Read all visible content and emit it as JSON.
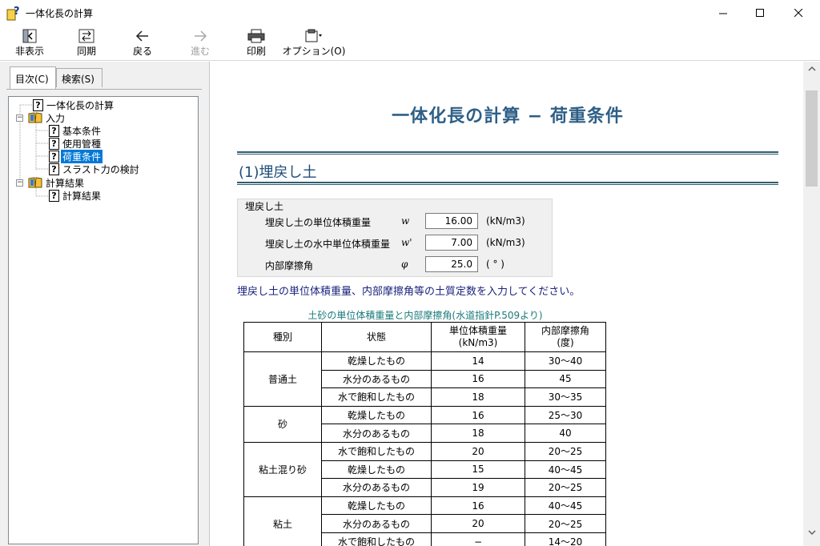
{
  "window": {
    "title": "一体化長の計算"
  },
  "toolbar": {
    "buttons": [
      {
        "label": "非表示",
        "icon": "hide-pane-icon"
      },
      {
        "label": "同期",
        "icon": "sync-icon"
      },
      {
        "label": "戻る",
        "icon": "back-arrow-icon"
      },
      {
        "label": "進む",
        "icon": "forward-arrow-icon",
        "disabled": true
      },
      {
        "label": "印刷",
        "icon": "printer-icon"
      },
      {
        "label": "オプション(O)",
        "icon": "options-icon"
      }
    ]
  },
  "navpane": {
    "tabs": [
      {
        "label": "目次(C)",
        "active": true
      },
      {
        "label": "検索(S)",
        "active": false
      }
    ],
    "tree": [
      {
        "label": "一体化長の計算",
        "type": "page",
        "level": 0
      },
      {
        "label": "入力",
        "type": "book",
        "level": 0,
        "expanded": true
      },
      {
        "label": "基本条件",
        "type": "page",
        "level": 1
      },
      {
        "label": "使用管種",
        "type": "page",
        "level": 1
      },
      {
        "label": "荷重条件",
        "type": "page",
        "level": 1,
        "selected": true
      },
      {
        "label": "スラスト力の検討",
        "type": "page",
        "level": 1
      },
      {
        "label": "計算結果",
        "type": "book",
        "level": 0,
        "expanded": true
      },
      {
        "label": "計算結果",
        "type": "page",
        "level": 1
      }
    ]
  },
  "content": {
    "page_title": "一体化長の計算 − 荷重条件",
    "section_title": "(1)埋戻し土",
    "groupbox": {
      "legend": "埋戻し土",
      "fields": [
        {
          "label": "埋戻し土の単位体積重量",
          "symbol": "w",
          "value": "16.00",
          "unit": "(kN/m3)"
        },
        {
          "label": "埋戻し土の水中単位体積重量",
          "symbol": "w'",
          "value": "7.00",
          "unit": "(kN/m3)"
        },
        {
          "label": "内部摩擦角",
          "symbol": "φ",
          "value": "25.0",
          "unit": "( ° )"
        }
      ]
    },
    "note": "埋戻し土の単位体積重量、内部摩擦角等の土質定数を入力してください。",
    "table": {
      "caption": "土砂の単位体積重量と内部摩擦角(水道指針P.509より)",
      "headers": {
        "type": "種別",
        "state": "状態",
        "weight": "単位体積重量",
        "weight_unit": "(kN/m3)",
        "angle": "内部摩擦角",
        "angle_unit": "(度)"
      },
      "groups": [
        {
          "type": "普通土",
          "rows": [
            {
              "state": "乾燥したもの",
              "weight": "14",
              "angle": "30〜40"
            },
            {
              "state": "水分のあるもの",
              "weight": "16",
              "angle": "45"
            },
            {
              "state": "水で飽和したもの",
              "weight": "18",
              "angle": "30〜35"
            }
          ]
        },
        {
          "type": "砂",
          "rows": [
            {
              "state": "乾燥したもの",
              "weight": "16",
              "angle": "25〜30"
            },
            {
              "state": "水分のあるもの",
              "weight": "18",
              "angle": "40"
            }
          ]
        },
        {
          "type": "粘土混り砂",
          "rows": [
            {
              "state": "水で飽和したもの",
              "weight": "20",
              "angle": "20〜25"
            },
            {
              "state": "乾燥したもの",
              "weight": "15",
              "angle": "40〜45"
            },
            {
              "state": "水分のあるもの",
              "weight": "19",
              "angle": "20〜25"
            }
          ]
        },
        {
          "type": "粘土",
          "rows": [
            {
              "state": "乾燥したもの",
              "weight": "16",
              "angle": "40〜45"
            },
            {
              "state": "水分のあるもの",
              "weight": "20",
              "angle": "20〜25"
            },
            {
              "state": "水で飽和したもの",
              "weight": "−",
              "angle": "14〜20"
            }
          ]
        }
      ]
    }
  }
}
